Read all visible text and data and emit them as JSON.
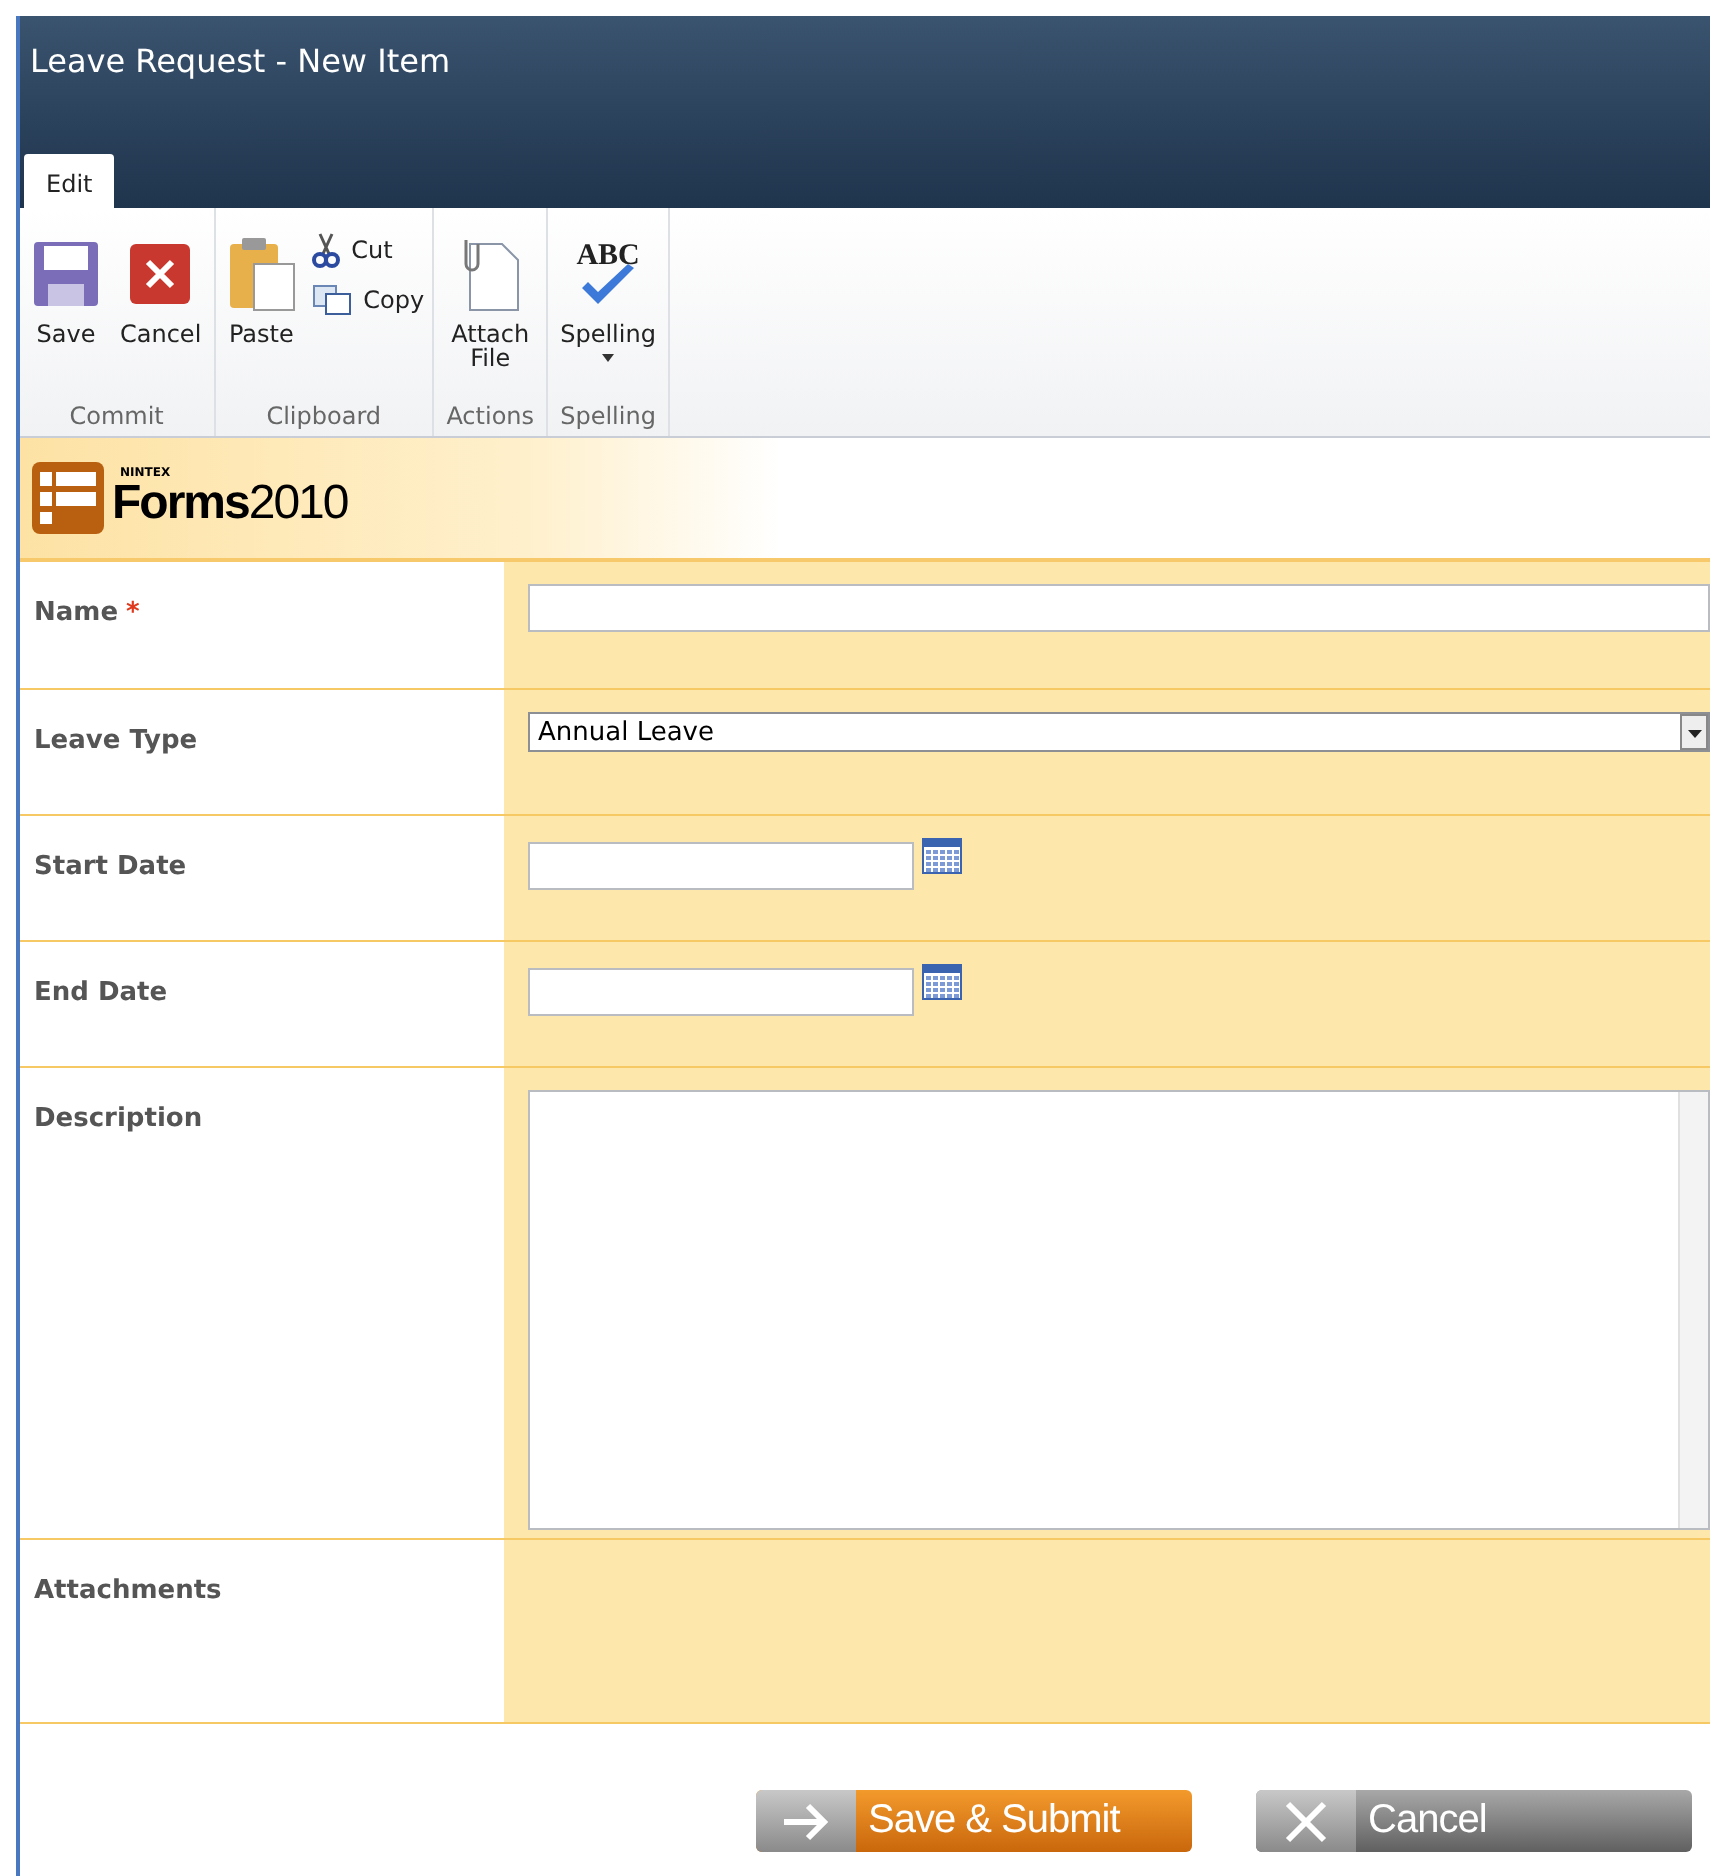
{
  "window": {
    "title": "Leave Request - New Item"
  },
  "tabs": [
    {
      "label": "Edit",
      "selected": true
    }
  ],
  "ribbon": [
    {
      "label": "Commit",
      "buttons": [
        {
          "kind": "save",
          "label": "Save"
        },
        {
          "kind": "cancel",
          "label": "Cancel"
        }
      ]
    },
    {
      "label": "Clipboard",
      "buttons": [
        {
          "kind": "paste",
          "label": "Paste"
        },
        {
          "kind": "cut",
          "label": "Cut"
        },
        {
          "kind": "copy",
          "label": "Copy"
        }
      ]
    },
    {
      "label": "Actions",
      "buttons": [
        {
          "kind": "attach",
          "label": "Attach File"
        }
      ]
    },
    {
      "label": "Spelling",
      "buttons": [
        {
          "kind": "spelling",
          "label": "Spelling",
          "icon_text": "ABC",
          "caret": true
        }
      ]
    }
  ],
  "logo": {
    "brand": "NINTEX",
    "product": "Forms",
    "version": "2010"
  },
  "fields": [
    {
      "kind": "text",
      "label": "Name",
      "required_mark": "*"
    },
    {
      "kind": "select",
      "label": "Leave Type",
      "value": "Annual Leave"
    },
    {
      "kind": "date",
      "label": "Start Date"
    },
    {
      "kind": "date",
      "label": "End Date"
    },
    {
      "kind": "textarea",
      "label": "Description"
    },
    {
      "kind": "attachments",
      "label": "Attachments"
    }
  ],
  "buttons": [
    {
      "kind": "submit",
      "label": "Save & Submit"
    },
    {
      "kind": "cancel",
      "label": "Cancel"
    }
  ]
}
